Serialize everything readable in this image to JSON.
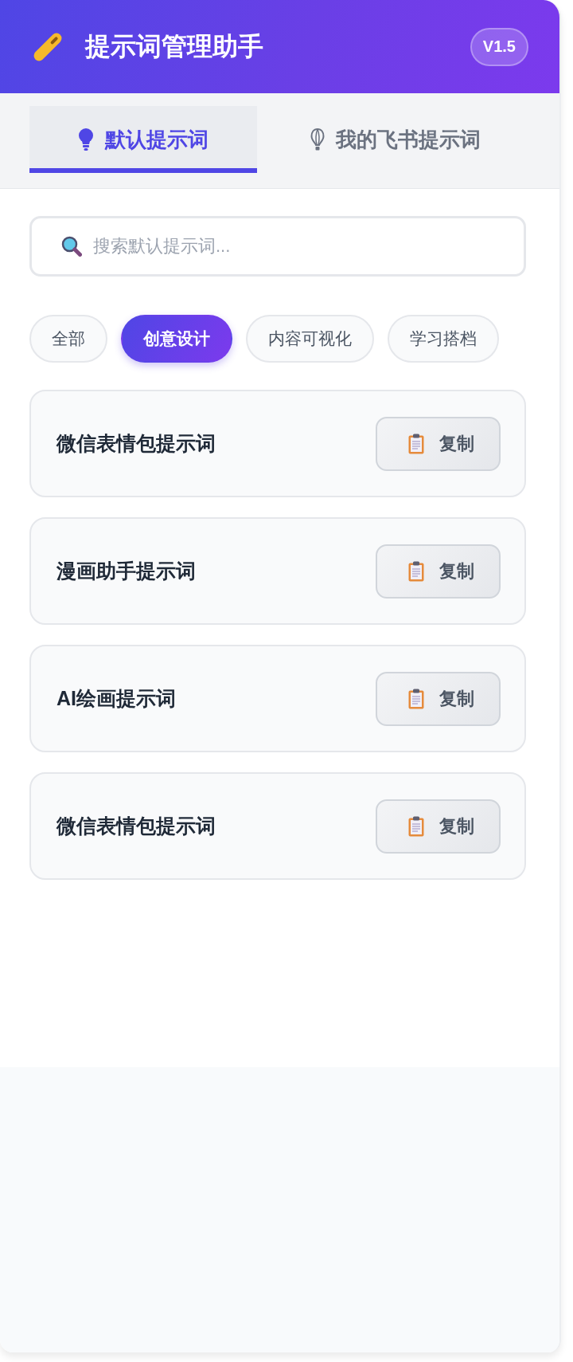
{
  "header": {
    "title": "提示词管理助手",
    "version": "V1.5"
  },
  "tabs": [
    {
      "label": "默认提示词",
      "selected": true
    },
    {
      "label": "我的飞书提示词",
      "selected": false
    }
  ],
  "search": {
    "placeholder": "搜索默认提示词..."
  },
  "categories": [
    {
      "label": "全部",
      "selected": false
    },
    {
      "label": "创意设计",
      "selected": true
    },
    {
      "label": "内容可视化",
      "selected": false
    },
    {
      "label": "学习搭档",
      "selected": false
    }
  ],
  "prompts": [
    {
      "title": "微信表情包提示词",
      "action": "复制"
    },
    {
      "title": "漫画助手提示词",
      "action": "复制"
    },
    {
      "title": "AI绘画提示词",
      "action": "复制"
    },
    {
      "title": "微信表情包提示词",
      "action": "复制"
    }
  ]
}
